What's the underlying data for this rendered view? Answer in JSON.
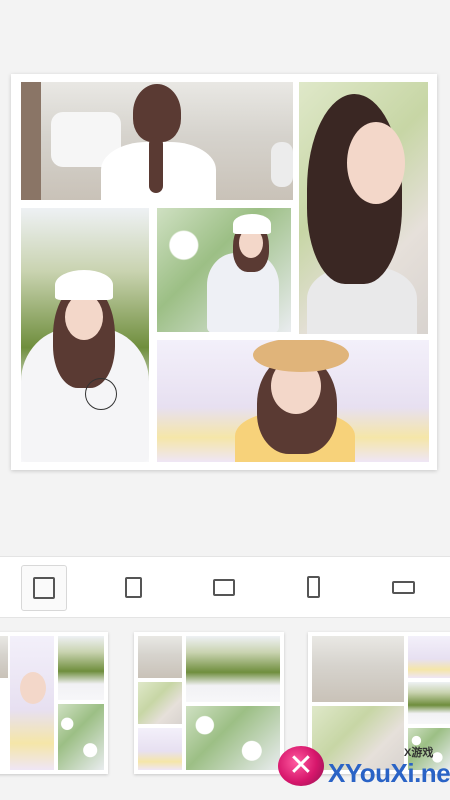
{
  "collage": {
    "photos": [
      {
        "name": "street-photo",
        "icon": "girl-braid-street-photo"
      },
      {
        "name": "portrait-photo",
        "icon": "girl-portrait-photo"
      },
      {
        "name": "hillside-photo",
        "icon": "girl-white-cap-hill-photo"
      },
      {
        "name": "flowers-photo",
        "icon": "girl-flowers-photo"
      },
      {
        "name": "straw-hat-photo",
        "icon": "girl-straw-hat-photo"
      }
    ]
  },
  "aspect_toolbar": {
    "selected": "square",
    "options": [
      {
        "id": "square",
        "icon": "aspect-square-icon"
      },
      {
        "id": "portrait-3-4",
        "icon": "aspect-portrait-icon"
      },
      {
        "id": "landscape-4-3",
        "icon": "aspect-landscape-icon"
      },
      {
        "id": "tall-9-16",
        "icon": "aspect-tall-icon"
      },
      {
        "id": "wide-16-9",
        "icon": "aspect-wide-icon"
      }
    ]
  },
  "templates": [
    {
      "id": "template-1",
      "layout": "grid-a"
    },
    {
      "id": "template-2",
      "layout": "grid-b"
    },
    {
      "id": "template-3",
      "layout": "grid-c"
    }
  ],
  "watermark": {
    "site": "XYouXi.net",
    "small": "X游戏",
    "logo_icon": "gamepad-x-logo-icon"
  },
  "colors": {
    "background": "#f3f3f3",
    "card": "#ffffff",
    "watermark_text": "#2a63c6",
    "watermark_logo": "#d6166b"
  }
}
